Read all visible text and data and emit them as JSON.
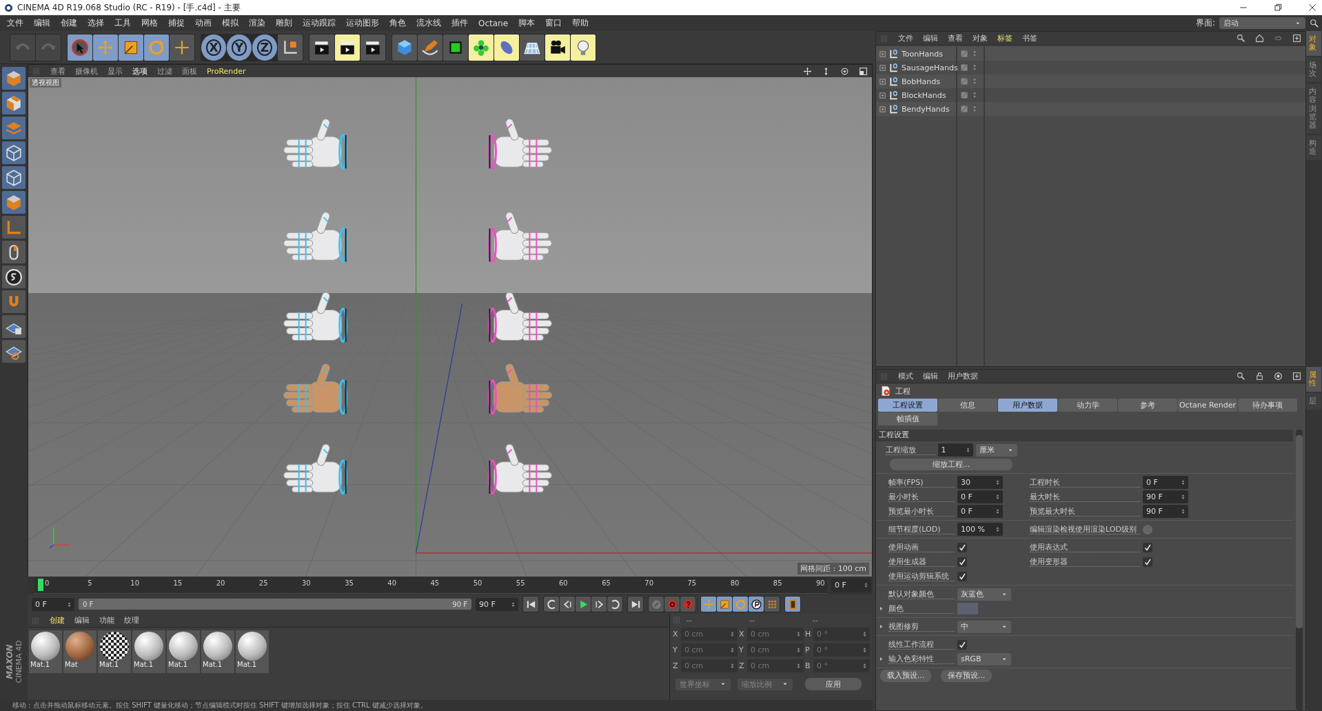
{
  "window": {
    "title": "CINEMA 4D R19.068 Studio (RC - R19) - [手.c4d] - 主要"
  },
  "menu": [
    "文件",
    "编辑",
    "创建",
    "选择",
    "工具",
    "网格",
    "捕捉",
    "动画",
    "模拟",
    "渲染",
    "雕刻",
    "运动跟踪",
    "运动图形",
    "角色",
    "流水线",
    "插件",
    "Octane",
    "脚本",
    "窗口",
    "帮助"
  ],
  "layout_switch": {
    "label": "界面:",
    "value": "启动"
  },
  "toolbar": {
    "axes": [
      {
        "label": "X",
        "on": true
      },
      {
        "label": "Y",
        "on": true
      },
      {
        "label": "Z",
        "on": true
      }
    ]
  },
  "viewport": {
    "menu": [
      {
        "label": "查看",
        "selected": false
      },
      {
        "label": "摄像机",
        "selected": false
      },
      {
        "label": "显示",
        "selected": false
      },
      {
        "label": "选项",
        "selected": true
      },
      {
        "label": "过滤",
        "selected": false
      },
      {
        "label": "面板",
        "selected": false
      },
      {
        "label": "ProRender",
        "selected": false,
        "plugin": true
      }
    ],
    "label": "透视视图",
    "grid_spacing": "网格间距 : 100 cm"
  },
  "timeline": {
    "ticks": [
      "0",
      "5",
      "10",
      "15",
      "20",
      "25",
      "30",
      "35",
      "40",
      "45",
      "50",
      "55",
      "60",
      "65",
      "70",
      "75",
      "80",
      "85",
      "90"
    ],
    "level": 0,
    "frame": "0 F",
    "start": "0 F",
    "range": {
      "start": "0 F",
      "end": "90 F",
      "level": 1
    },
    "end": "90 F"
  },
  "materials": {
    "menu": [
      {
        "label": "创建",
        "selected": true
      },
      {
        "label": "编辑",
        "selected": false
      },
      {
        "label": "功能",
        "selected": false
      },
      {
        "label": "纹理",
        "selected": false
      }
    ],
    "items": [
      {
        "name": "Mat.1",
        "kind": "white"
      },
      {
        "name": "Mat",
        "kind": "brown"
      },
      {
        "name": "Mat.1",
        "kind": "checker"
      },
      {
        "name": "Mat.1",
        "kind": "white"
      },
      {
        "name": "Mat.1",
        "kind": "white"
      },
      {
        "name": "Mat.1",
        "kind": "white"
      },
      {
        "name": "Mat.1",
        "kind": "white"
      }
    ]
  },
  "coordinates": {
    "headers": [
      "--",
      "--",
      "--"
    ],
    "rows": [
      [
        {
          "axis": "X",
          "value": "0 cm",
          "disabled": true
        },
        {
          "axis": "X",
          "value": "0 cm",
          "disabled": true
        },
        {
          "axis": "H",
          "value": "0 °",
          "disabled": true
        }
      ],
      [
        {
          "axis": "Y",
          "value": "0 cm",
          "disabled": true
        },
        {
          "axis": "Y",
          "value": "0 cm",
          "disabled": true
        },
        {
          "axis": "P",
          "value": "0 °",
          "disabled": true
        }
      ],
      [
        {
          "axis": "Z",
          "value": "0 cm",
          "disabled": true
        },
        {
          "axis": "Z",
          "value": "0 cm",
          "disabled": true
        },
        {
          "axis": "B",
          "value": "0 °",
          "disabled": true
        }
      ]
    ],
    "modes": [
      "世界坐标",
      "缩放比例"
    ],
    "apply": "应用"
  },
  "logo": {
    "brand": "MAXON",
    "product": "CINEMA 4D"
  },
  "status_bar": "移动：点击并拖动鼠标移动元素。按住 SHIFT 键量化移动；节点编辑模式时按住 SHIFT 键增加选择对象；按住 CTRL 键减少选择对象。",
  "objects": {
    "menu": [
      {
        "label": "文件",
        "selected": false
      },
      {
        "label": "编辑",
        "selected": false
      },
      {
        "label": "查看",
        "selected": false
      },
      {
        "label": "对象",
        "selected": false
      },
      {
        "label": "标签",
        "selected": true
      },
      {
        "label": "书签",
        "selected": false
      }
    ],
    "items": [
      "ToonHands",
      "SausageHands",
      "BobHands",
      "BlockHands",
      "BendyHands"
    ]
  },
  "side_tabs": {
    "top": [
      {
        "label": "对象",
        "selected": true
      },
      {
        "label": "场次",
        "selected": false
      },
      {
        "label": "内容浏览器",
        "selected": false
      },
      {
        "label": "构造",
        "selected": false
      }
    ],
    "bottom": [
      {
        "label": "属性",
        "selected": true
      },
      {
        "label": "层",
        "selected": false
      }
    ]
  },
  "attributes": {
    "menu": [
      "模式",
      "编辑",
      "用户数据"
    ],
    "title": "工程",
    "tabs": [
      {
        "label": "工程设置",
        "selected": true
      },
      {
        "label": "信息",
        "selected": false
      },
      {
        "label": "用户数据",
        "selected": true
      },
      {
        "label": "动力学",
        "selected": false
      },
      {
        "label": "参考",
        "selected": false
      },
      {
        "label": "Octane Render",
        "selected": false
      },
      {
        "label": "待办事项",
        "selected": false
      },
      {
        "label": "帧插值",
        "selected": false
      }
    ],
    "section": "工程设置",
    "groups": [
      [
        [
          {
            "kind": "number",
            "label": "工程缩放",
            "value": "1",
            "expandable": false
          },
          {
            "kind": "dropdown",
            "value": "厘米"
          }
        ],
        [
          {
            "kind": "button",
            "text": "缩放工程..."
          }
        ]
      ],
      [
        [
          {
            "kind": "number",
            "label": "帧率(FPS)",
            "value": "30",
            "expandable": false
          },
          {
            "kind": "number",
            "label": "工程时长",
            "value": "0 F",
            "expandable": false
          }
        ],
        [
          {
            "kind": "number",
            "label": "最小时长",
            "value": "0 F",
            "expandable": false
          },
          {
            "kind": "number",
            "label": "最大时长",
            "value": "90 F",
            "expandable": false
          }
        ],
        [
          {
            "kind": "number",
            "label": "预览最小时长",
            "value": "0 F",
            "expandable": false
          },
          {
            "kind": "number",
            "label": "预览最大时长",
            "value": "90 F",
            "expandable": false
          }
        ]
      ],
      [
        [
          {
            "kind": "number",
            "label": "细节程度(LOD)",
            "value": "100 %",
            "expandable": false
          },
          {
            "kind": "check",
            "label": "编辑渲染检视使用渲染LOD级别",
            "checked": false,
            "expandable": false
          }
        ]
      ],
      [
        [
          {
            "kind": "check",
            "label": "使用动画",
            "checked": true,
            "expandable": false
          },
          {
            "kind": "check",
            "label": "使用表达式",
            "checked": true,
            "expandable": false
          }
        ],
        [
          {
            "kind": "check",
            "label": "使用生成器",
            "checked": true,
            "expandable": false
          },
          {
            "kind": "check",
            "label": "使用变形器",
            "checked": true,
            "expandable": false
          }
        ],
        [
          {
            "kind": "check",
            "label": "使用运动剪辑系统",
            "checked": true,
            "expandable": false
          }
        ]
      ],
      [
        [
          {
            "kind": "dropdown",
            "label": "默认对象颜色",
            "value": "灰蓝色",
            "expandable": false
          }
        ],
        [
          {
            "kind": "color",
            "label": "颜色",
            "color": "#5d6070",
            "expandable": true
          }
        ]
      ],
      [
        [
          {
            "kind": "dropdown",
            "label": "视图修剪",
            "value": "中",
            "expandable": true
          }
        ]
      ],
      [
        [
          {
            "kind": "check",
            "label": "线性工作流程",
            "checked": true,
            "expandable": false
          }
        ],
        [
          {
            "kind": "dropdown",
            "label": "输入色彩特性",
            "value": "sRGB",
            "expandable": true
          }
        ]
      ]
    ],
    "buttons": [
      "载入预设...",
      "保存预设..."
    ]
  }
}
